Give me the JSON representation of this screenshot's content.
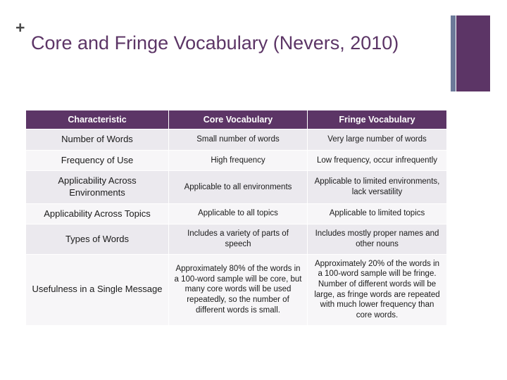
{
  "slide": {
    "plus_marker": "+",
    "title": "Core and Fringe Vocabulary (Nevers, 2010)",
    "accent_color": "#5c3566",
    "secondary_color": "#6c7a99"
  },
  "table": {
    "headers": [
      "Characteristic",
      "Core Vocabulary",
      "Fringe Vocabulary"
    ],
    "rows": [
      {
        "characteristic": "Number of Words",
        "core": "Small number of words",
        "fringe": "Very large number of words"
      },
      {
        "characteristic": "Frequency of Use",
        "core": "High frequency",
        "fringe": "Low frequency, occur infrequently"
      },
      {
        "characteristic": "Applicability Across Environments",
        "core": "Applicable to all environments",
        "fringe": "Applicable to limited environments, lack versatility"
      },
      {
        "characteristic": "Applicability Across Topics",
        "core": "Applicable to all topics",
        "fringe": "Applicable to limited topics"
      },
      {
        "characteristic": "Types of Words",
        "core": "Includes a variety of parts of speech",
        "fringe": "Includes mostly proper names and other nouns"
      },
      {
        "characteristic": "Usefulness in a Single Message",
        "core": "Approximately 80% of the words in a 100-word sample will be core, but many core words will be used repeatedly, so the number of different words is small.",
        "fringe": "Approximately 20% of the words in a 100-word sample will be fringe.  Number of different words will be large, as fringe words are repeated with much lower frequency than core words."
      }
    ]
  }
}
